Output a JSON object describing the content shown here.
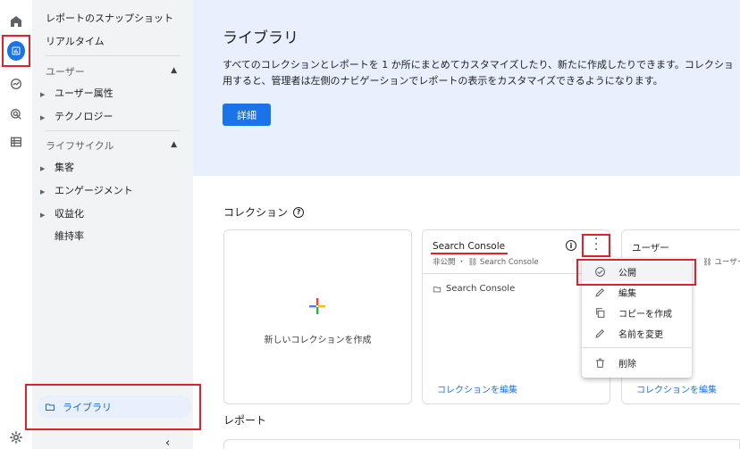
{
  "sidebar": {
    "top_items": [
      "レポートのスナップショット",
      "リアルタイム"
    ],
    "sections": [
      {
        "label": "ユーザー",
        "items": [
          "ユーザー属性",
          "テクノロジー"
        ]
      },
      {
        "label": "ライフサイクル",
        "items": [
          "集客",
          "エンゲージメント",
          "収益化"
        ],
        "plain": "維持率"
      }
    ],
    "library_label": "ライブラリ",
    "collapse_glyph": "‹"
  },
  "banner": {
    "title": "ライブラリ",
    "desc_line1": "すべてのコレクションとレポートを 1 か所にまとめてカスタマイズしたり、新たに作成したりできます。コレクショ",
    "desc_line2": "用すると、管理者は左側のナビゲーションでレポートの表示をカスタマイズできるようになります。",
    "button": "詳細"
  },
  "collections": {
    "heading": "コレクション",
    "new_label": "新しいコレクションを作成",
    "cards": [
      {
        "title": "Search Console",
        "status": "非公開",
        "source": "Search Console",
        "row": "Search Console",
        "link": "コレクションを編集"
      },
      {
        "title": "ユーザー",
        "source": "ユーザー",
        "row_suffix": "性",
        "link": "コレクションを編集"
      }
    ]
  },
  "reports": {
    "heading": "レポート"
  },
  "menu": {
    "items": [
      "公開",
      "編集",
      "コピーを作成",
      "名前を変更",
      "削除"
    ]
  },
  "colors": {
    "accent": "#1a73e8",
    "highlight": "#e0202a",
    "banner_bg": "#e8f0fe",
    "sidebar_bg": "#f1f3f4"
  }
}
